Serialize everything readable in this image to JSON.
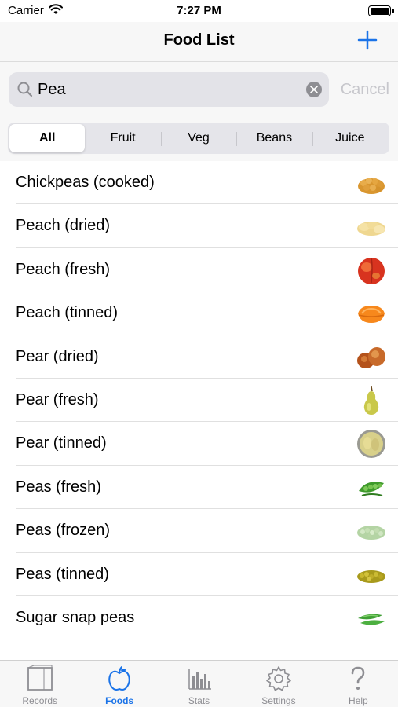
{
  "status_bar": {
    "carrier": "Carrier",
    "time": "7:27 PM"
  },
  "nav": {
    "title": "Food List",
    "add_icon": "plus-icon"
  },
  "search": {
    "value": "Pea",
    "cancel_label": "Cancel"
  },
  "segments": [
    {
      "label": "All",
      "selected": true
    },
    {
      "label": "Fruit"
    },
    {
      "label": "Veg"
    },
    {
      "label": "Beans"
    },
    {
      "label": "Juice"
    }
  ],
  "foods": [
    {
      "name": "Chickpeas (cooked)",
      "thumb": "chickpeas-thumbnail"
    },
    {
      "name": "Peach (dried)",
      "thumb": "dried-peach-thumbnail"
    },
    {
      "name": "Peach (fresh)",
      "thumb": "fresh-peach-thumbnail"
    },
    {
      "name": "Peach (tinned)",
      "thumb": "tinned-peach-thumbnail"
    },
    {
      "name": "Pear (dried)",
      "thumb": "dried-pear-thumbnail"
    },
    {
      "name": "Pear (fresh)",
      "thumb": "fresh-pear-thumbnail"
    },
    {
      "name": "Pear (tinned)",
      "thumb": "tinned-pear-thumbnail"
    },
    {
      "name": "Peas (fresh)",
      "thumb": "fresh-peas-thumbnail"
    },
    {
      "name": "Peas (frozen)",
      "thumb": "frozen-peas-thumbnail"
    },
    {
      "name": "Peas (tinned)",
      "thumb": "tinned-peas-thumbnail"
    },
    {
      "name": "Sugar snap peas",
      "thumb": "sugar-snap-peas-thumbnail"
    }
  ],
  "tabs": [
    {
      "label": "Records",
      "icon": "records-icon"
    },
    {
      "label": "Foods",
      "icon": "apple-icon",
      "active": true
    },
    {
      "label": "Stats",
      "icon": "bar-chart-icon"
    },
    {
      "label": "Settings",
      "icon": "gear-icon"
    },
    {
      "label": "Help",
      "icon": "question-mark-icon"
    }
  ],
  "colors": {
    "accent": "#1a73e8",
    "inactive": "#8e8e93",
    "bar_background": "#f7f7f7"
  }
}
